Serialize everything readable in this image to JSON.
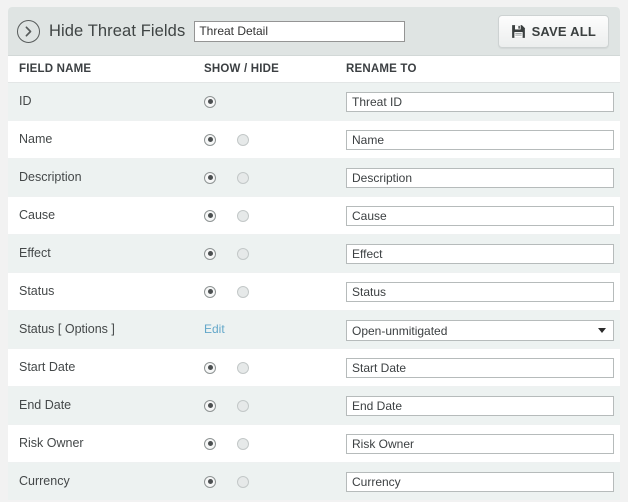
{
  "header": {
    "collapse_icon": "chevron-right-circle-icon",
    "title": "Hide Threat Fields",
    "name_input_value": "Threat Detail",
    "name_input_placeholder": "",
    "save_button": {
      "icon": "floppy-disk-save-icon",
      "label": "SAVE ALL"
    }
  },
  "columns": {
    "field_name": "FIELD NAME",
    "show_hide": "SHOW / HIDE",
    "rename_to": "RENAME TO"
  },
  "rows": [
    {
      "field": "ID",
      "control": "radios",
      "show_selected": true,
      "has_hide_radio": false,
      "rename_type": "input",
      "rename_value": "Threat ID"
    },
    {
      "field": "Name",
      "control": "radios",
      "show_selected": true,
      "has_hide_radio": true,
      "rename_type": "input",
      "rename_value": "Name"
    },
    {
      "field": "Description",
      "control": "radios",
      "show_selected": true,
      "has_hide_radio": true,
      "rename_type": "input",
      "rename_value": "Description"
    },
    {
      "field": "Cause",
      "control": "radios",
      "show_selected": true,
      "has_hide_radio": true,
      "rename_type": "input",
      "rename_value": "Cause"
    },
    {
      "field": "Effect",
      "control": "radios",
      "show_selected": true,
      "has_hide_radio": true,
      "rename_type": "input",
      "rename_value": "Effect"
    },
    {
      "field": "Status",
      "control": "radios",
      "show_selected": true,
      "has_hide_radio": true,
      "rename_type": "input",
      "rename_value": "Status"
    },
    {
      "field": "Status [ Options ]",
      "control": "link",
      "link_label": "Edit",
      "rename_type": "select",
      "rename_value": "Open-unmitigated"
    },
    {
      "field": "Start Date",
      "control": "radios",
      "show_selected": true,
      "has_hide_radio": true,
      "rename_type": "input",
      "rename_value": "Start Date"
    },
    {
      "field": "End Date",
      "control": "radios",
      "show_selected": true,
      "has_hide_radio": true,
      "rename_type": "input",
      "rename_value": "End Date"
    },
    {
      "field": "Risk Owner",
      "control": "radios",
      "show_selected": true,
      "has_hide_radio": true,
      "rename_type": "input",
      "rename_value": "Risk Owner"
    },
    {
      "field": "Currency",
      "control": "radios",
      "show_selected": true,
      "has_hide_radio": true,
      "rename_type": "input",
      "rename_value": "Currency"
    }
  ],
  "colors": {
    "header_bg": "#dfe4e3",
    "row_alt_bg": "#edf2f1",
    "link": "#63a7c9",
    "page_bg": "#f2f2f2"
  }
}
